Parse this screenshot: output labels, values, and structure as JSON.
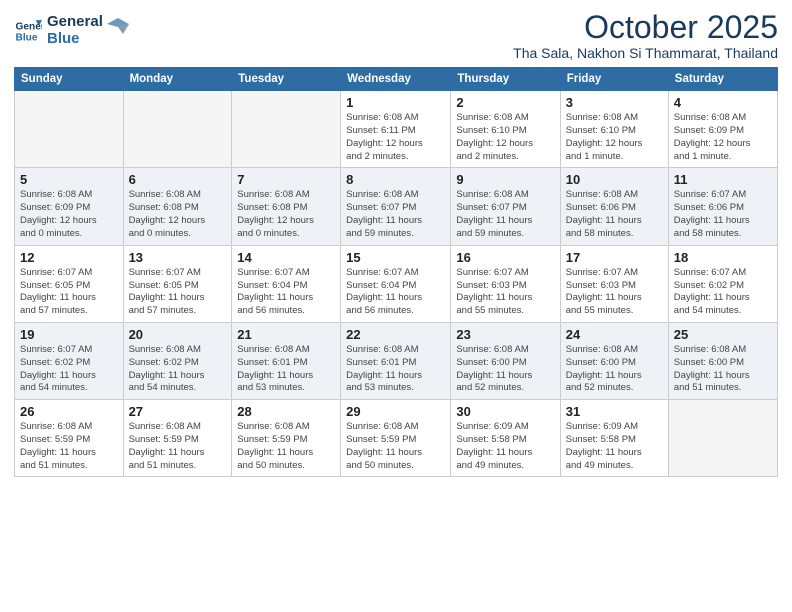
{
  "logo": {
    "line1": "General",
    "line2": "Blue"
  },
  "title": "October 2025",
  "location": "Tha Sala, Nakhon Si Thammarat, Thailand",
  "days_of_week": [
    "Sunday",
    "Monday",
    "Tuesday",
    "Wednesday",
    "Thursday",
    "Friday",
    "Saturday"
  ],
  "weeks": [
    [
      {
        "day": "",
        "info": ""
      },
      {
        "day": "",
        "info": ""
      },
      {
        "day": "",
        "info": ""
      },
      {
        "day": "1",
        "info": "Sunrise: 6:08 AM\nSunset: 6:11 PM\nDaylight: 12 hours\nand 2 minutes."
      },
      {
        "day": "2",
        "info": "Sunrise: 6:08 AM\nSunset: 6:10 PM\nDaylight: 12 hours\nand 2 minutes."
      },
      {
        "day": "3",
        "info": "Sunrise: 6:08 AM\nSunset: 6:10 PM\nDaylight: 12 hours\nand 1 minute."
      },
      {
        "day": "4",
        "info": "Sunrise: 6:08 AM\nSunset: 6:09 PM\nDaylight: 12 hours\nand 1 minute."
      }
    ],
    [
      {
        "day": "5",
        "info": "Sunrise: 6:08 AM\nSunset: 6:09 PM\nDaylight: 12 hours\nand 0 minutes."
      },
      {
        "day": "6",
        "info": "Sunrise: 6:08 AM\nSunset: 6:08 PM\nDaylight: 12 hours\nand 0 minutes."
      },
      {
        "day": "7",
        "info": "Sunrise: 6:08 AM\nSunset: 6:08 PM\nDaylight: 12 hours\nand 0 minutes."
      },
      {
        "day": "8",
        "info": "Sunrise: 6:08 AM\nSunset: 6:07 PM\nDaylight: 11 hours\nand 59 minutes."
      },
      {
        "day": "9",
        "info": "Sunrise: 6:08 AM\nSunset: 6:07 PM\nDaylight: 11 hours\nand 59 minutes."
      },
      {
        "day": "10",
        "info": "Sunrise: 6:08 AM\nSunset: 6:06 PM\nDaylight: 11 hours\nand 58 minutes."
      },
      {
        "day": "11",
        "info": "Sunrise: 6:07 AM\nSunset: 6:06 PM\nDaylight: 11 hours\nand 58 minutes."
      }
    ],
    [
      {
        "day": "12",
        "info": "Sunrise: 6:07 AM\nSunset: 6:05 PM\nDaylight: 11 hours\nand 57 minutes."
      },
      {
        "day": "13",
        "info": "Sunrise: 6:07 AM\nSunset: 6:05 PM\nDaylight: 11 hours\nand 57 minutes."
      },
      {
        "day": "14",
        "info": "Sunrise: 6:07 AM\nSunset: 6:04 PM\nDaylight: 11 hours\nand 56 minutes."
      },
      {
        "day": "15",
        "info": "Sunrise: 6:07 AM\nSunset: 6:04 PM\nDaylight: 11 hours\nand 56 minutes."
      },
      {
        "day": "16",
        "info": "Sunrise: 6:07 AM\nSunset: 6:03 PM\nDaylight: 11 hours\nand 55 minutes."
      },
      {
        "day": "17",
        "info": "Sunrise: 6:07 AM\nSunset: 6:03 PM\nDaylight: 11 hours\nand 55 minutes."
      },
      {
        "day": "18",
        "info": "Sunrise: 6:07 AM\nSunset: 6:02 PM\nDaylight: 11 hours\nand 54 minutes."
      }
    ],
    [
      {
        "day": "19",
        "info": "Sunrise: 6:07 AM\nSunset: 6:02 PM\nDaylight: 11 hours\nand 54 minutes."
      },
      {
        "day": "20",
        "info": "Sunrise: 6:08 AM\nSunset: 6:02 PM\nDaylight: 11 hours\nand 54 minutes."
      },
      {
        "day": "21",
        "info": "Sunrise: 6:08 AM\nSunset: 6:01 PM\nDaylight: 11 hours\nand 53 minutes."
      },
      {
        "day": "22",
        "info": "Sunrise: 6:08 AM\nSunset: 6:01 PM\nDaylight: 11 hours\nand 53 minutes."
      },
      {
        "day": "23",
        "info": "Sunrise: 6:08 AM\nSunset: 6:00 PM\nDaylight: 11 hours\nand 52 minutes."
      },
      {
        "day": "24",
        "info": "Sunrise: 6:08 AM\nSunset: 6:00 PM\nDaylight: 11 hours\nand 52 minutes."
      },
      {
        "day": "25",
        "info": "Sunrise: 6:08 AM\nSunset: 6:00 PM\nDaylight: 11 hours\nand 51 minutes."
      }
    ],
    [
      {
        "day": "26",
        "info": "Sunrise: 6:08 AM\nSunset: 5:59 PM\nDaylight: 11 hours\nand 51 minutes."
      },
      {
        "day": "27",
        "info": "Sunrise: 6:08 AM\nSunset: 5:59 PM\nDaylight: 11 hours\nand 51 minutes."
      },
      {
        "day": "28",
        "info": "Sunrise: 6:08 AM\nSunset: 5:59 PM\nDaylight: 11 hours\nand 50 minutes."
      },
      {
        "day": "29",
        "info": "Sunrise: 6:08 AM\nSunset: 5:59 PM\nDaylight: 11 hours\nand 50 minutes."
      },
      {
        "day": "30",
        "info": "Sunrise: 6:09 AM\nSunset: 5:58 PM\nDaylight: 11 hours\nand 49 minutes."
      },
      {
        "day": "31",
        "info": "Sunrise: 6:09 AM\nSunset: 5:58 PM\nDaylight: 11 hours\nand 49 minutes."
      },
      {
        "day": "",
        "info": ""
      }
    ]
  ],
  "row_shades": [
    false,
    true,
    false,
    true,
    false
  ]
}
